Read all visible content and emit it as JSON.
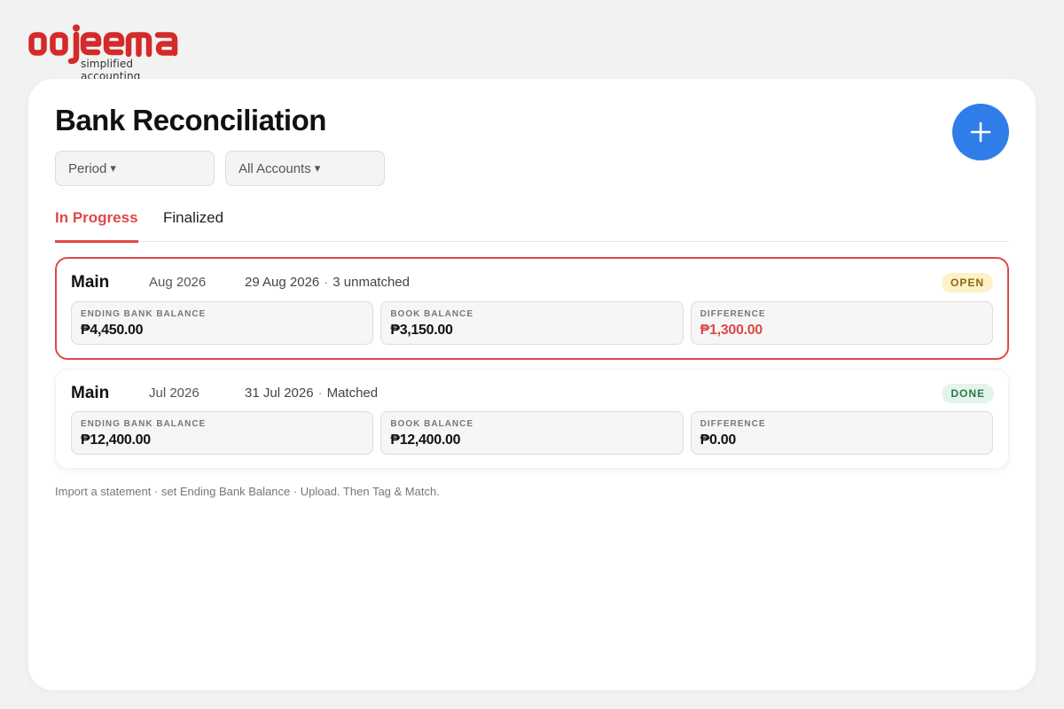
{
  "brand": {
    "name": "oojeema",
    "tagline": "simplified accounting",
    "color": "#d42a2a"
  },
  "page": {
    "title": "Bank Reconciliation",
    "add_button_icon": "plus-icon",
    "accent_color": "#2f7de8"
  },
  "filters": {
    "period_label": "Period",
    "accounts_label": "All Accounts",
    "caret": "▾"
  },
  "tabs": [
    {
      "label": "In Progress",
      "active": true
    },
    {
      "label": "Finalized",
      "active": false
    }
  ],
  "reconciliations": [
    {
      "account": "Main",
      "period": "Aug 2026",
      "date": "29 Aug 2026",
      "separator": "·",
      "match_status": "3 unmatched",
      "status_badge": "OPEN",
      "selected": true,
      "ending_bank_balance_label": "ENDING BANK BALANCE",
      "ending_bank_balance": "₱4,450.00",
      "book_balance_label": "BOOK BALANCE",
      "book_balance": "₱3,150.00",
      "difference_label": "DIFFERENCE",
      "difference": "₱1,300.00"
    },
    {
      "account": "Main",
      "period": "Jul 2026",
      "date": "31 Jul 2026",
      "separator": "·",
      "match_status": "Matched",
      "status_badge": "DONE",
      "selected": false,
      "ending_bank_balance_label": "ENDING BANK BALANCE",
      "ending_bank_balance": "₱12,400.00",
      "book_balance_label": "BOOK BALANCE",
      "book_balance": "₱12,400.00",
      "difference_label": "DIFFERENCE",
      "difference": "₱0.00"
    }
  ],
  "hint": "Import a statement · set Ending Bank Balance · Upload. Then Tag & Match.",
  "colors": {
    "danger": "#e04848",
    "open_badge_bg": "#fdf1c8",
    "done_badge_bg": "#e4f4ea"
  }
}
